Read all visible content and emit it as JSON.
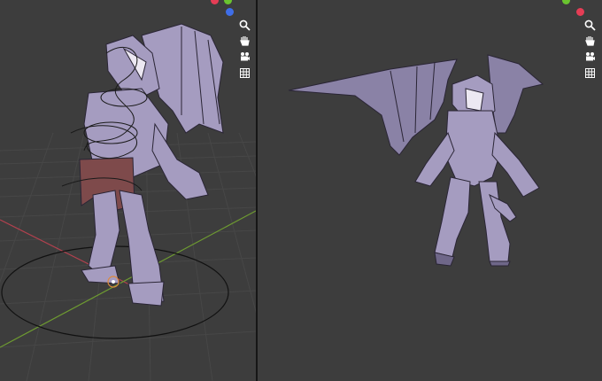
{
  "viewports": {
    "left": {
      "mode": "pose-edit-with-rig"
    },
    "right": {
      "mode": "object-view"
    }
  },
  "navigation_icons": [
    "zoom-icon",
    "pan-hand-icon",
    "camera-icon",
    "grid-view-icon"
  ],
  "gizmo_colors": {
    "x_axis": "#e53d55",
    "y_axis": "#6ac42f",
    "z_axis": "#3f6ee8",
    "grid_line": "#4a4a4a",
    "x_line": "#b3414e",
    "y_line": "#6e9b31",
    "model_body": "#a59cc0",
    "model_shadow": "#6f6789",
    "model_outline": "#2a2535",
    "loincloth": "#7e4a4b",
    "background": "#3d3d3d"
  }
}
